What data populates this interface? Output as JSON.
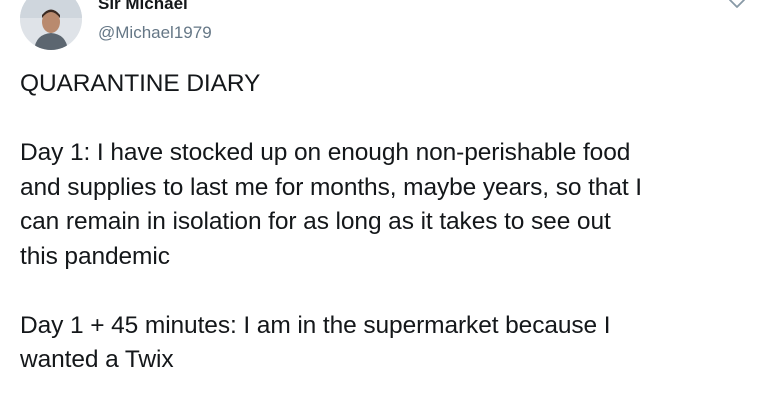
{
  "tweet": {
    "display_name": "Sir Michael",
    "username": "@Michael1979",
    "avatar_icon": "avatar-photo-icon",
    "menu_icon": "chevron-down-icon",
    "title_line": "QUARANTINE DIARY",
    "day1": {
      "line1": "Day 1: I have stocked up on enough non-perishable food",
      "line2": "and supplies to last me for months, maybe years, so that I",
      "line3": "can remain in isolation for as long as it takes to see out",
      "line4": "this pandemic"
    },
    "day1_45": {
      "line1": "Day 1 + 45 minutes: I am in the supermarket because I",
      "line2": "wanted a Twix"
    }
  }
}
